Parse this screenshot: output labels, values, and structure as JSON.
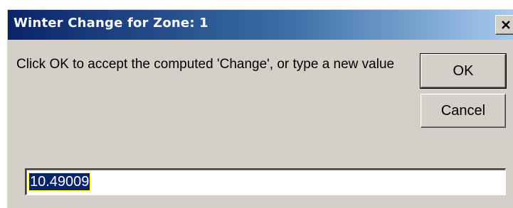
{
  "window": {
    "title": "Winter Change for Zone:  1",
    "close_label": "×"
  },
  "message": "Click OK to accept the computed 'Change', or type a new value",
  "buttons": {
    "ok": "OK",
    "cancel": "Cancel"
  },
  "input": {
    "value": "10.49009"
  },
  "icons": {
    "close": "close-icon"
  },
  "colors": {
    "titlebar_start": "#0a246a",
    "titlebar_end": "#a6caf0",
    "face": "#d4d0c8",
    "selection": "#0a246a"
  }
}
